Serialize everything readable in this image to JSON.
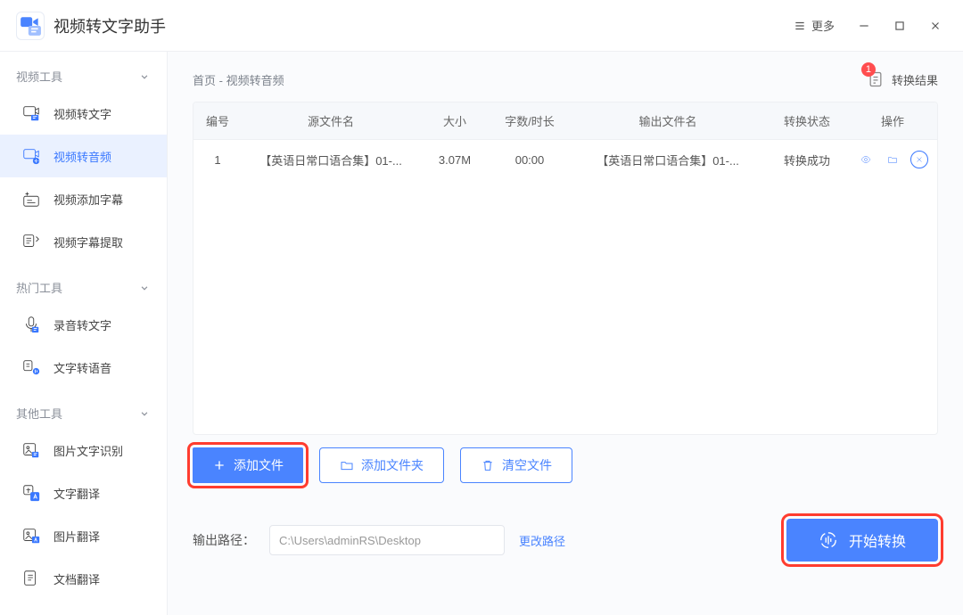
{
  "titlebar": {
    "app_name": "视频转文字助手",
    "more_label": "更多"
  },
  "sidebar": {
    "groups": [
      {
        "title": "视频工具",
        "items": [
          "视频转文字",
          "视频转音频",
          "视频添加字幕",
          "视频字幕提取"
        ],
        "active_index": 1
      },
      {
        "title": "热门工具",
        "items": [
          "录音转文字",
          "文字转语音"
        ]
      },
      {
        "title": "其他工具",
        "items": [
          "图片文字识别",
          "文字翻译",
          "图片翻译",
          "文档翻译"
        ]
      }
    ]
  },
  "breadcrumb": {
    "home": "首页",
    "sep": " - ",
    "current": "视频转音频"
  },
  "results": {
    "label": "转换结果",
    "count": "1"
  },
  "table": {
    "headers": [
      "编号",
      "源文件名",
      "大小",
      "字数/时长",
      "输出文件名",
      "转换状态",
      "操作"
    ],
    "rows": [
      {
        "index": "1",
        "src_name": "【英语日常口语合集】01-...",
        "size": "3.07M",
        "duration": "00:00",
        "out_name": "【英语日常口语合集】01-...",
        "status": "转换成功"
      }
    ]
  },
  "toolbar": {
    "add_file": "添加文件",
    "add_folder": "添加文件夹",
    "clear": "清空文件"
  },
  "footer": {
    "path_label": "输出路径：",
    "path_value": "C:\\Users\\adminRS\\Desktop",
    "change_path": "更改路径",
    "start": "开始转换"
  }
}
